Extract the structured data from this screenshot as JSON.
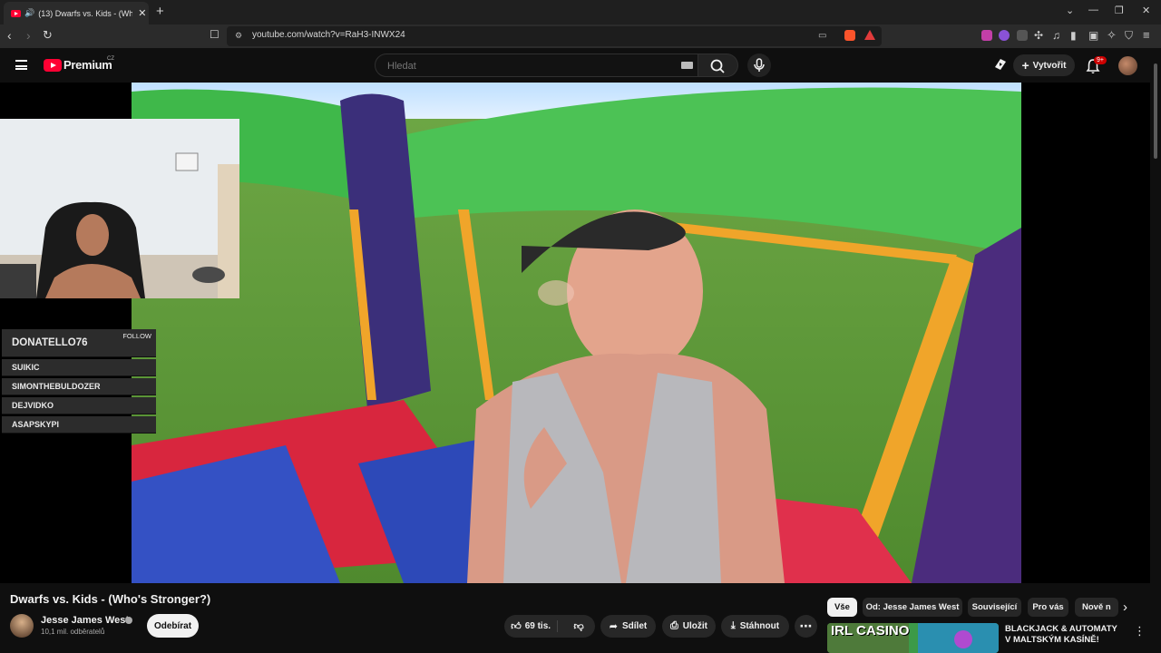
{
  "browser": {
    "tab_title": "(13) Dwarfs vs. Kids - (Who's Stronger?)",
    "new_tab_label": "+",
    "url": "youtube.com/watch?v=RaH3-INWX24"
  },
  "header": {
    "brand": "Premium",
    "region": "CZ",
    "search_placeholder": "Hledat",
    "create_label": "Vytvořit",
    "notifications_count": "9+"
  },
  "overlay": {
    "followers": [
      {
        "name": "DONATELLO76",
        "action": "FOLLOW"
      },
      {
        "name": "SUIKIC"
      },
      {
        "name": "SIMONTHEBULDOZER"
      },
      {
        "name": "DEJVIDKO"
      },
      {
        "name": "ASAPSKYPI"
      }
    ]
  },
  "video": {
    "title": "Dwarfs vs. Kids - (Who's Stronger?)",
    "channel": "Jesse James West",
    "subscribers": "10,1 mil. odběratelů",
    "subscribe_label": "Odebírat",
    "likes": "69 tis.",
    "share_label": "Sdílet",
    "save_label": "Uložit",
    "download_label": "Stáhnout"
  },
  "filters": {
    "chips": [
      "Vše",
      "Od: Jesse James West",
      "Související",
      "Pro vás",
      "Nově n"
    ]
  },
  "recommendation": {
    "thumbnail_text": "IRL CASINO",
    "title": "BLACKJACK & AUTOMATY V MALTSKÝM KASÍNĚ!"
  },
  "colors": {
    "accent": "#ff0033",
    "background": "#0f0f0f"
  }
}
